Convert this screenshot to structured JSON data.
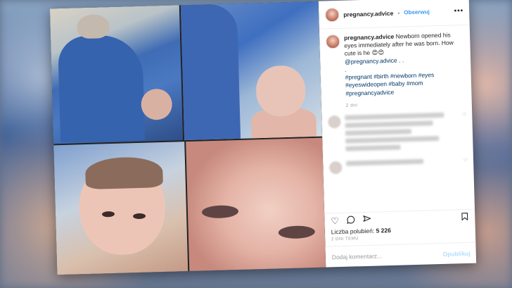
{
  "post": {
    "username": "pregnancy.advice",
    "separator": "•",
    "follow_label": "Obserwuj",
    "more_label": "•••",
    "caption_username": "pregnancy.advice",
    "caption_text": "Newborn opened his eyes immediately after he was born. How cute is he 😍😍",
    "caption_mention": "@pregnancy.advice",
    "caption_dots": ". .",
    "caption_dot2": ".",
    "hashtags": "#pregnant #birth #newborn #eyes #eyeswideopen #baby #mom #pregnancyadvice",
    "time_ago": "2 dni",
    "likes_label": "Liczba polubień:",
    "likes_count": "5 226",
    "date": "2 DNI TEMU",
    "comment_placeholder": "Dodaj komentarz...",
    "publish_label": "Opublikuj"
  },
  "icons": {
    "like": "heart-icon",
    "comment": "comment-icon",
    "share": "share-icon",
    "save": "bookmark-icon",
    "more": "more-options-icon"
  },
  "colors": {
    "link": "#3897f0",
    "hashtag": "#003569",
    "publish_disabled": "#b2dffc"
  }
}
